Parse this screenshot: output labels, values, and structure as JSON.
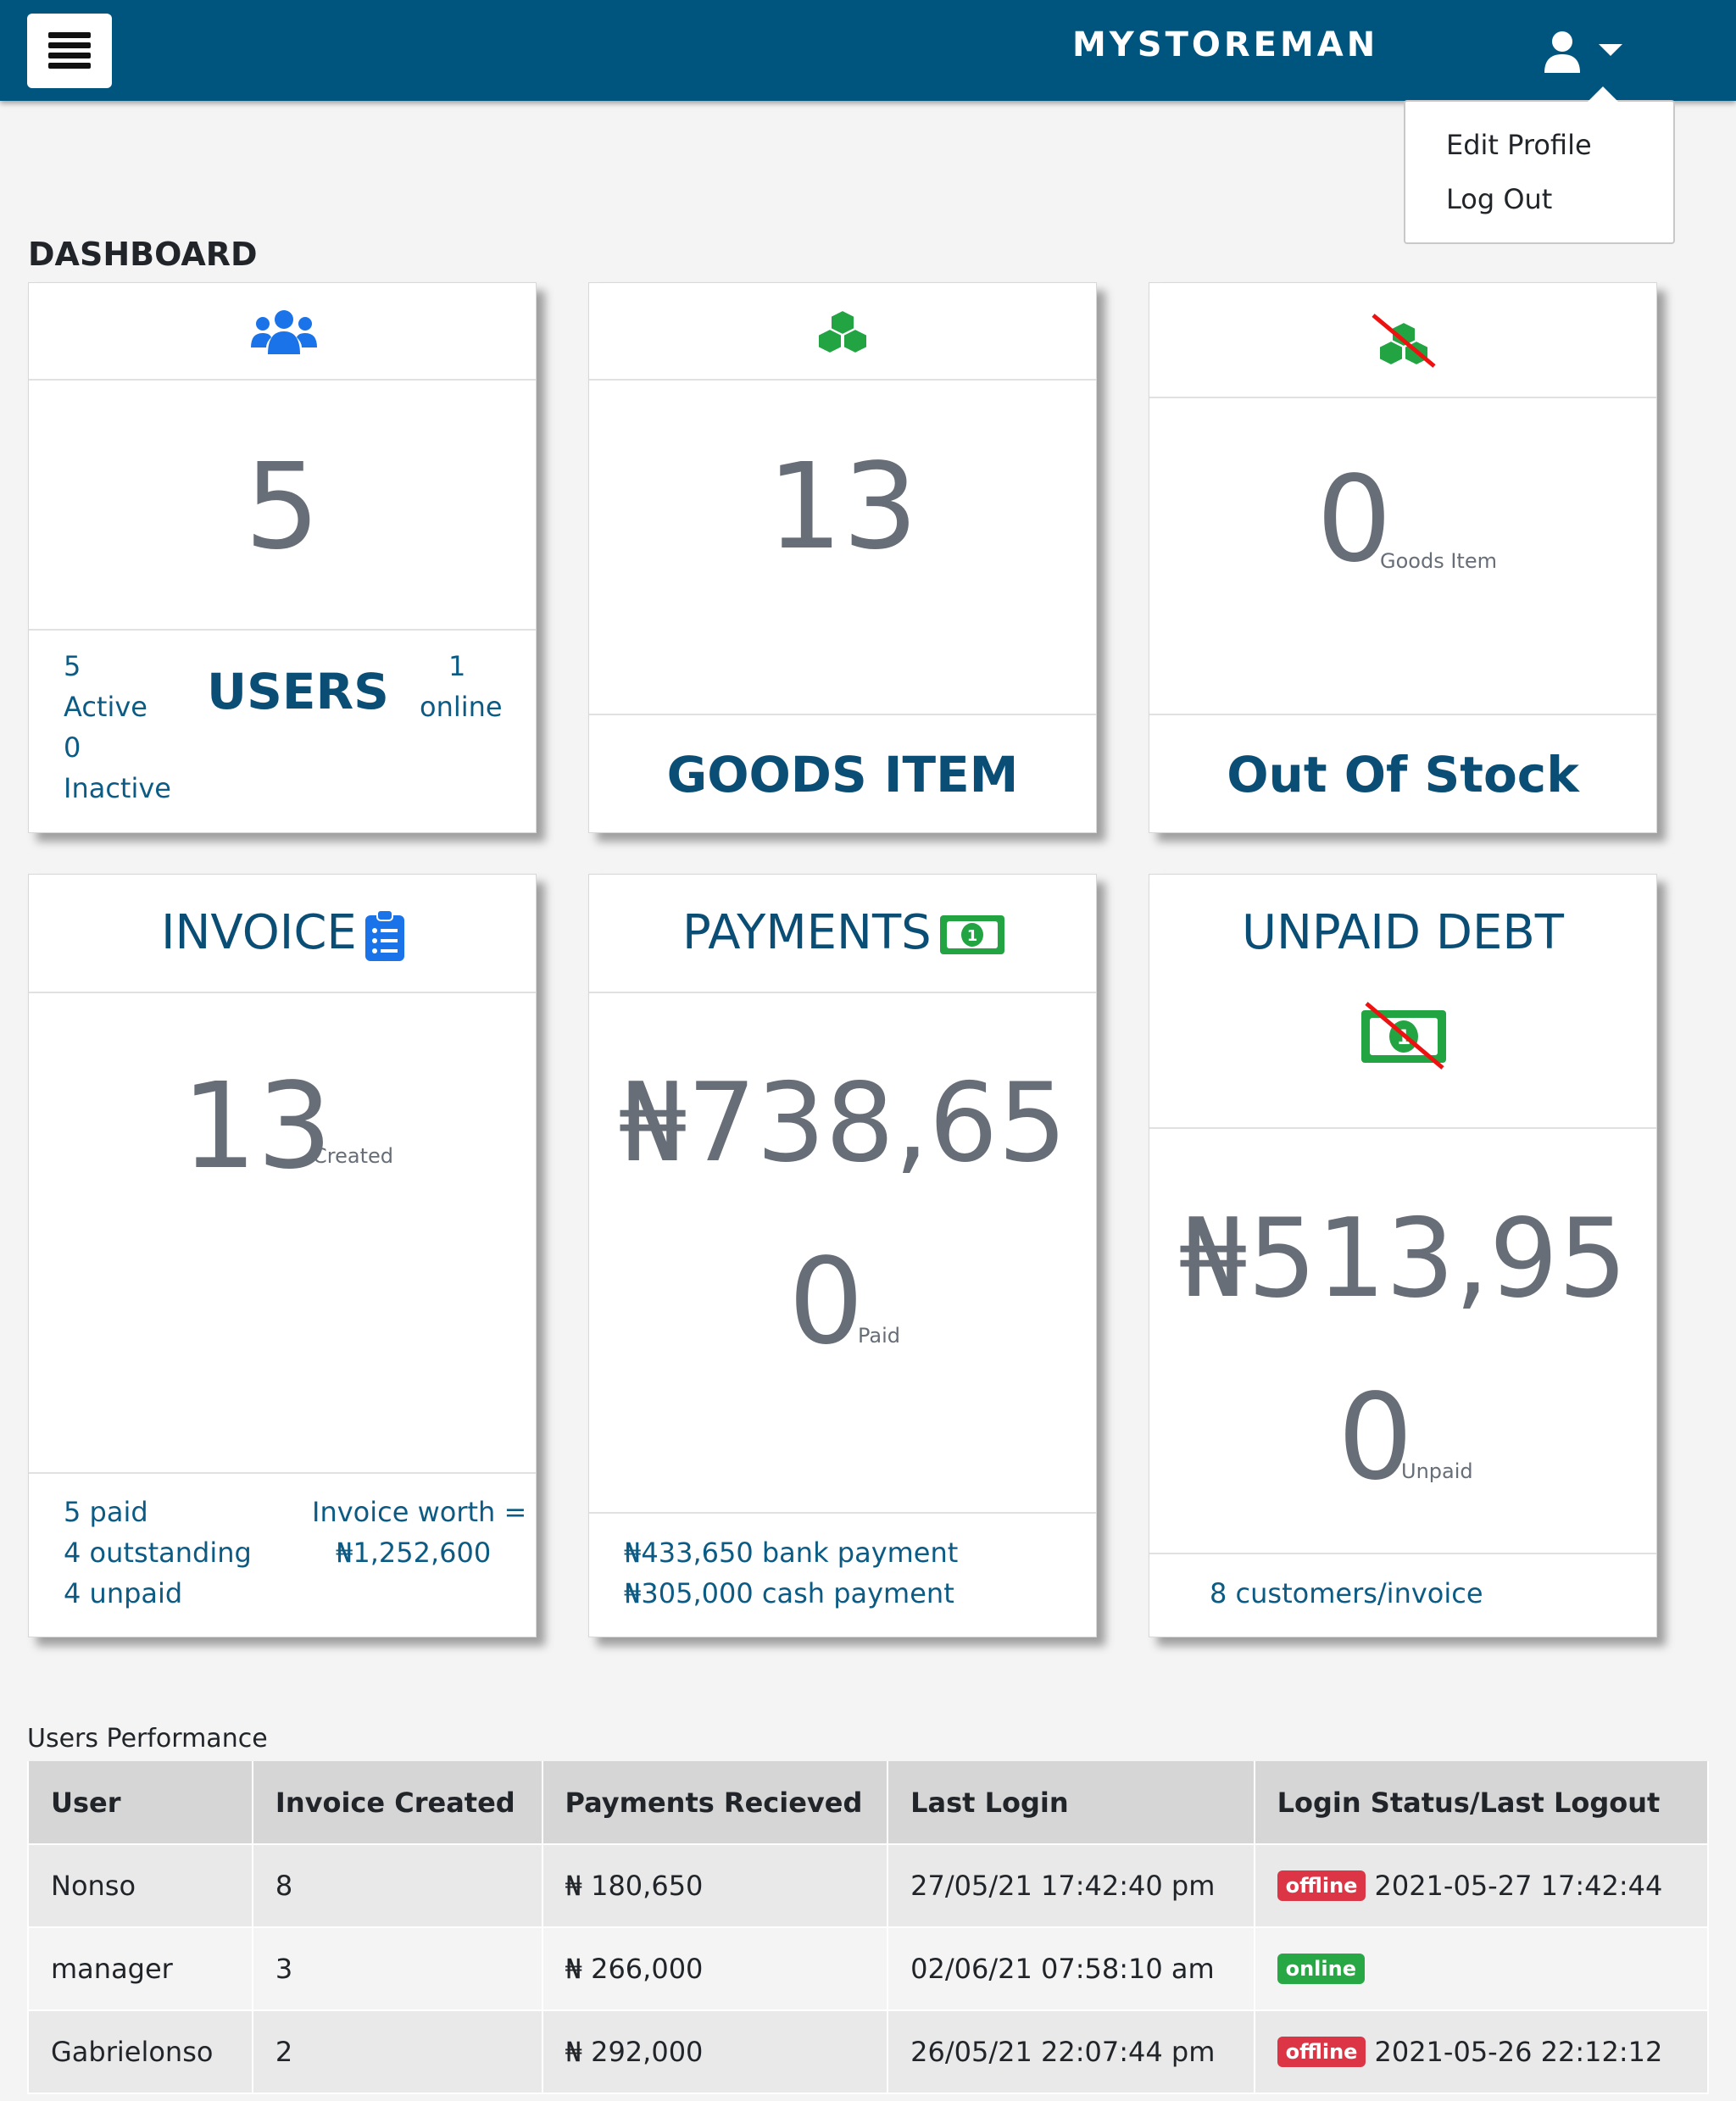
{
  "header": {
    "brand": "MYSTOREMAN",
    "dropdown": {
      "edit_profile": "Edit Profile",
      "log_out": "Log Out"
    }
  },
  "page_title": "DASHBOARD",
  "cards": {
    "users": {
      "count": "5",
      "label": "USERS",
      "active_count": "5",
      "active_label": "Active",
      "inactive_count": "0",
      "inactive_label": "Inactive",
      "online_count": "1",
      "online_label": "online"
    },
    "goods": {
      "count": "13",
      "label": "GOODS ITEM"
    },
    "out_of_stock": {
      "count": "0",
      "unit": "Goods Item",
      "label": "Out Of Stock"
    },
    "invoice": {
      "title": "INVOICE",
      "count": "13",
      "count_label": "Created",
      "paid": "5 paid",
      "outstanding": "4 outstanding",
      "unpaid": "4 unpaid",
      "worth_label": "Invoice worth =",
      "worth_value": "₦1,252,600"
    },
    "payments": {
      "title": "PAYMENTS",
      "amount": "₦738,65",
      "count": "0",
      "count_label": "Paid",
      "bank": "₦433,650 bank payment",
      "cash": "₦305,000 cash payment"
    },
    "unpaid_debt": {
      "title": "UNPAID DEBT",
      "amount": "₦513,95",
      "count": "0",
      "count_label": "Unpaid",
      "customers": "8 customers/invoice"
    }
  },
  "performance": {
    "title": "Users Performance",
    "headers": [
      "User",
      "Invoice Created",
      "Payments Recieved",
      "Last Login",
      "Login Status/Last Logout"
    ],
    "rows": [
      {
        "user": "Nonso",
        "invoices": "8",
        "payments": "₦ 180,650",
        "last_login": "27/05/21 17:42:40 pm",
        "status": "offline",
        "last_logout": "2021-05-27 17:42:44"
      },
      {
        "user": "manager",
        "invoices": "3",
        "payments": "₦ 266,000",
        "last_login": "02/06/21 07:58:10 am",
        "status": "online",
        "last_logout": ""
      },
      {
        "user": "Gabrielonso",
        "invoices": "2",
        "payments": "₦ 292,000",
        "last_login": "26/05/21 22:07:44 pm",
        "status": "offline",
        "last_logout": "2021-05-26 22:12:12"
      }
    ]
  },
  "colors": {
    "header_bg": "#00557f",
    "accent_text": "#0b4e75",
    "green_icon": "#22a443",
    "blue_icon": "#1a73e8",
    "offline": "#dc3545",
    "online": "#28a745"
  }
}
